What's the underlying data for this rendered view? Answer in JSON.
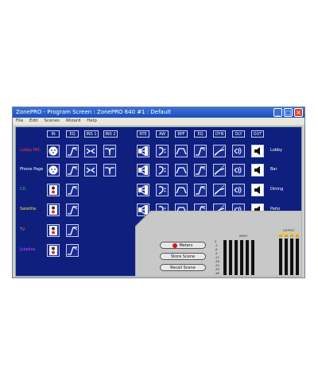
{
  "window": {
    "title": "ZonePRO - Program Screen   :   ZonePRO 640 #1   :   Default"
  },
  "menu": [
    "File",
    "Edit",
    "Scenes",
    "Wizard",
    "Help"
  ],
  "input_headers": [
    "IN",
    "EQ",
    "INS 1",
    "INS 2"
  ],
  "output_headers": [
    "RTE",
    "AW",
    "BPF",
    "EQ",
    "DYN",
    "DLY",
    "OUT"
  ],
  "inputs": [
    {
      "label": "Lobby MIC",
      "color": "#ff3a3a"
    },
    {
      "label": "Phone Page",
      "color": "#ffffff"
    },
    {
      "label": "CD",
      "color": "#39d339"
    },
    {
      "label": "Satellite",
      "color": "#f0e040"
    },
    {
      "label": "TV",
      "color": "#ff7a2a"
    },
    {
      "label": "Jukebox",
      "color": "#c04dff"
    }
  ],
  "outputs": [
    "Lobby",
    "Bar",
    "Dining",
    "Patio"
  ],
  "buttons": {
    "meters": "Meters",
    "store": "Store Scene",
    "recall": "Recall Scene"
  },
  "meters": {
    "input_label": "INPUT",
    "output_label": "OUTPUT"
  },
  "scale": [
    "0",
    "-3",
    "-6",
    "-9",
    "-12",
    "-18",
    "-24",
    "-30",
    "-48"
  ]
}
